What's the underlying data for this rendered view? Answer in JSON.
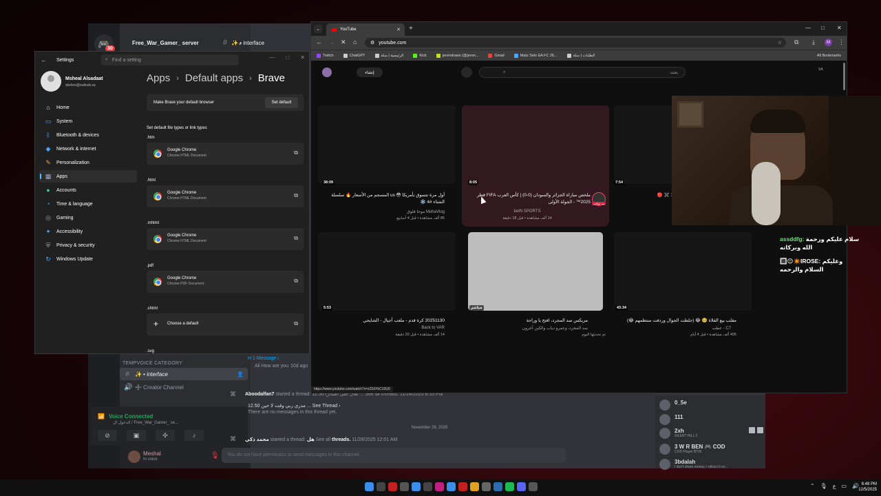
{
  "discord": {
    "server_name": "Free_War_Gamer_ server",
    "server_badge": "30",
    "channel_header": "✨ • interface",
    "category": "TEMPVOICE CATEGORY",
    "channels": [
      {
        "icon": "#",
        "label": "✨ • interface"
      },
      {
        "icon": "🔊",
        "label": "➕ Creator Channel"
      }
    ],
    "voice": {
      "status": "Voice Connected",
      "sub": "الدخول ال / Free_War_Gamer_ se..."
    },
    "user": {
      "name": "Meshal",
      "status": "In voice"
    },
    "messages": {
      "thread_top": "H 1 Message ›",
      "thread_top_sub": "Ali How are you",
      "thread_top_time": "10d ago",
      "m1_author": "Aboodalfan7",
      "m1_text": "started a thread: 12.50 (تعال على اصدار ... See all threads. 11/28/2025 8:53 PM",
      "m1_thread_title": "12.50 مدري ربي وقت لا حين ... See Thread ›",
      "m1_thread_sub": "There are no messages in this thread yet.",
      "date_sep": "November 28, 2025",
      "m2_author": "محمد ذكي",
      "m2_text": "started a thread:",
      "m2_thread": "هل",
      "m2_see": "See all",
      "m2_threads": "threads.",
      "m2_time": "11/28/2025 12:01 AM",
      "input_placeholder": "You do not have permission to send messages in this channel."
    },
    "members": [
      {
        "name": "0_5e",
        "sub": ""
      },
      {
        "name": "111",
        "sub": ""
      },
      {
        "name": "2xh",
        "sub": "SILENT HILL 2"
      },
      {
        "name": "3 W R BEN 🎮 COD",
        "sub": "COD Player BTW"
      },
      {
        "name": "3bdalah",
        "sub": "I don't share money, I attract it wi..."
      }
    ]
  },
  "settings": {
    "title": "Settings",
    "search_placeholder": "Find a setting",
    "profile_name": "Msheal Alsadaat",
    "profile_email": "xbshox@outlook.sa",
    "nav": [
      {
        "icon": "⌂",
        "label": "Home",
        "color": "#e0e0e0"
      },
      {
        "icon": "▭",
        "label": "System",
        "color": "#4aa8ff"
      },
      {
        "icon": "ᛒ",
        "label": "Bluetooth & devices",
        "color": "#4aa8ff"
      },
      {
        "icon": "◆",
        "label": "Network & internet",
        "color": "#4aa8ff"
      },
      {
        "icon": "✎",
        "label": "Personalization",
        "color": "#f0a050"
      },
      {
        "icon": "▦",
        "label": "Apps",
        "color": "#9aa8c8"
      },
      {
        "icon": "●",
        "label": "Accounts",
        "color": "#3ecf8e"
      },
      {
        "icon": "◔",
        "label": "Time & language",
        "color": "#4aa8ff"
      },
      {
        "icon": "◎",
        "label": "Gaming",
        "color": "#a0a0a0"
      },
      {
        "icon": "✦",
        "label": "Accessibility",
        "color": "#4aa8ff"
      },
      {
        "icon": "⛨",
        "label": "Privacy & security",
        "color": "#a0a0a0"
      },
      {
        "icon": "↻",
        "label": "Windows Update",
        "color": "#4aa8ff"
      }
    ],
    "breadcrumb": [
      "Apps",
      "Default apps",
      "Brave"
    ],
    "make_default_text": "Make Brave your default browser",
    "set_default_label": "Set default",
    "section_title": "Set default file types or link types",
    "file_types": [
      {
        "ext": ".htm",
        "app": "Google Chrome",
        "desc": "Chrome HTML Document"
      },
      {
        "ext": ".html",
        "app": "Google Chrome",
        "desc": "Chrome HTML Document"
      },
      {
        "ext": ".mhtml",
        "app": "Google Chrome",
        "desc": "Chrome HTML Document"
      },
      {
        "ext": ".pdf",
        "app": "Google Chrome",
        "desc": "Chrome PDF Document"
      },
      {
        "ext": ".shtml",
        "app": "Choose a default",
        "desc": ""
      },
      {
        "ext": ".svg",
        "app": "",
        "desc": ""
      }
    ]
  },
  "browser": {
    "tab_title": "YouTube",
    "url": "youtube.com",
    "profile_initial": "M",
    "bookmarks": [
      {
        "label": "Twitch",
        "color": "#9146ff"
      },
      {
        "label": "ChatGPT",
        "color": "#cccccc"
      },
      {
        "label": "الرئيسية | سلة",
        "color": "#cccccc"
      },
      {
        "label": "Kick",
        "color": "#53fc18"
      },
      {
        "label": "jerendraws (@jeren...",
        "color": "#c8e020"
      },
      {
        "label": "Gmail",
        "color": "#ea4335"
      },
      {
        "label": "Matz Sels EA FC 26...",
        "color": "#4aa8ff"
      },
      {
        "label": "الطلبات | سلة",
        "color": "#cccccc"
      }
    ],
    "all_bookmarks": "All Bookmarks",
    "yt_chip": "إنشاء",
    "yt_search_placeholder": "بحث",
    "yt_country": "SA",
    "videos": [
      {
        "duration": "38:09",
        "title": "أول مرة نتسوق بأمريكا 😳 us المسجم من الأسعار 🔥 سلسلة الشتاء #4 ❄️",
        "channel": "MohaVlog موحا فلوق",
        "meta": "85 ألف مشاهدة • قبل 4 أسابيع"
      },
      {
        "duration": "8:05",
        "title": "ملخص مباراة الجزائر والسودان (0-0) | كأس العرب FIFA قطر 2025™ - الجولة الأولى",
        "channel": "beIN SPORTS",
        "meta": "14 ألف مشاهدة • قبل 18 دقيقة",
        "badge": "بث مباشر"
      },
      {
        "duration": "7:54",
        "title": "1 ✖️ 🔴",
        "channel": "",
        "meta": ""
      },
      {
        "duration": "5:53",
        "title": "20251130 كرة قدم - ملعب أجيال - الشايجي",
        "channel": "Back to VAR",
        "meta": "14 ألف مشاهدة • قبل 20 دقيقة"
      },
      {
        "duration": "مباشر",
        "title": "مزيكس سد المجرد، افتح يا وراحة",
        "channel": "سد المجرد، وعمرو دياب والكين آخرون",
        "meta": "تم تحديثها اليوم"
      },
      {
        "duration": "43:34",
        "title": "مقلب بيع الفلاة 🥺 😂 (جلطت الجوال وردفت منتظمهم 😂)",
        "channel": "C7 - عطب",
        "meta": "405 ألف مشاهدة • قبل 4 أيام"
      }
    ],
    "status_url": "https://www.youtube.com/watch?v=z22dYbC10U0"
  },
  "chat": [
    {
      "user": "assddfg:",
      "text": "سلام عليكم ورحمة الله وبركاته",
      "user_color": "#6ee07a"
    },
    {
      "user": "🔳😊✴️IROSE:",
      "text": "وعليكم السلام والرحمه",
      "user_color": "#ffffff"
    }
  ],
  "taskbar": {
    "time": "6:48 PM",
    "date": "12/5/2025",
    "lang": "ع"
  }
}
